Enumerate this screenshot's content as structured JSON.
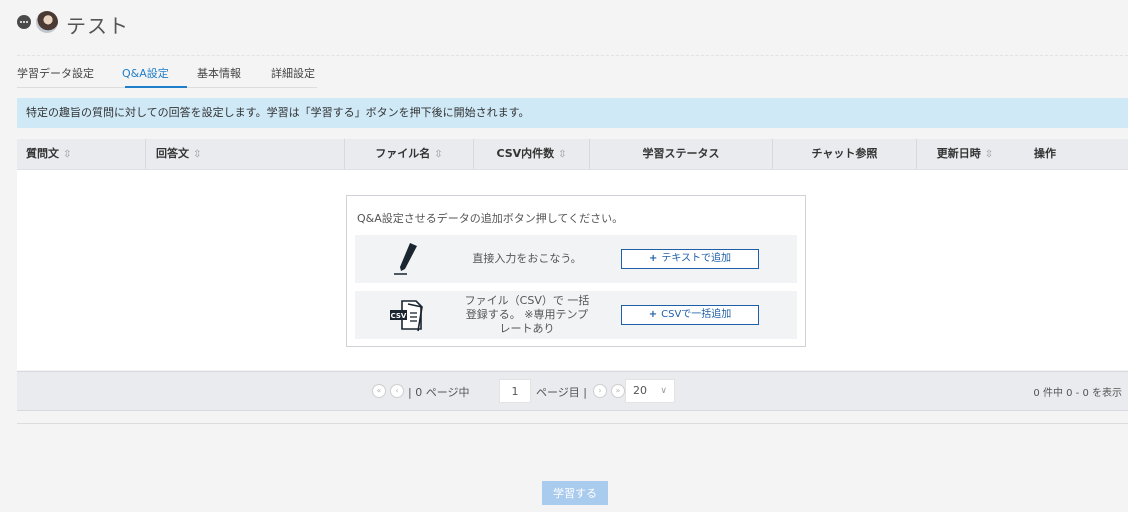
{
  "header": {
    "title": "テスト",
    "chat_icon": "chat-bubble-icon",
    "avatar": "avatar-image"
  },
  "tabs": [
    {
      "label": "学習データ設定",
      "active": false
    },
    {
      "label": "Q&A設定",
      "active": true
    },
    {
      "label": "基本情報",
      "active": false
    },
    {
      "label": "詳細設定",
      "active": false
    }
  ],
  "banner": {
    "text": "特定の趣旨の質問に対しての回答を設定します。学習は「学習する」ボタンを押下後に開始されます。"
  },
  "table": {
    "columns": [
      {
        "label": "質問文",
        "sortable": true
      },
      {
        "label": "回答文",
        "sortable": true
      },
      {
        "label": "ファイル名",
        "sortable": true
      },
      {
        "label": "CSV内件数",
        "sortable": true
      },
      {
        "label": "学習ステータス",
        "sortable": false
      },
      {
        "label": "チャット参照",
        "sortable": false
      },
      {
        "label": "更新日時",
        "sortable": true
      },
      {
        "label": "操作",
        "sortable": false
      }
    ],
    "sort_icon": "⇳",
    "rows": []
  },
  "add_panel": {
    "prompt": "Q&A設定させるデータの追加ボタン押してください。",
    "text_option": {
      "icon": "pen-icon",
      "description": "直接入力をおこなう。",
      "button_label": "テキストで追加"
    },
    "csv_option": {
      "icon": "csv-file-icon",
      "description_lines": [
        "ファイル（CSV）で 一括",
        "登録する。 ※専用テンプ",
        "レートあり"
      ],
      "button_label": "CSVで一括追加",
      "icon_text": "CSV"
    },
    "plus_symbol": "+"
  },
  "pagination": {
    "first_icon": "«",
    "prev_icon": "‹",
    "next_icon": "›",
    "last_icon": "»",
    "total_pages_label": "| 0 ページ中",
    "current_page": "1",
    "page_suffix": "ページ目 |",
    "page_size": "20",
    "summary": "0 件中 0 - 0 を表示"
  },
  "footer": {
    "learn_button_label": "学習する"
  },
  "colors": {
    "accent": "#1f7ec9",
    "banner_bg": "#cfe9f7",
    "button_disabled": "#a9cbee",
    "button_border": "#1e5fa8"
  }
}
